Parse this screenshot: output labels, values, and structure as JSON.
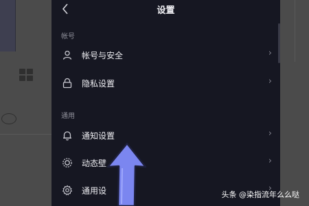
{
  "header": {
    "back_icon": "chevron-left-icon",
    "title": "设置"
  },
  "sections": [
    {
      "heading": "帐号",
      "items": [
        {
          "label": "帐号与安全",
          "icon": "user-icon"
        },
        {
          "label": "隐私设置",
          "icon": "lock-icon"
        }
      ]
    },
    {
      "heading": "通用",
      "items": [
        {
          "label": "通知设置",
          "icon": "bell-icon"
        },
        {
          "label": "动态壁",
          "icon": "wallpaper-icon"
        },
        {
          "label": "通用设",
          "icon": "gear-icon"
        }
      ]
    }
  ],
  "chevron_glyph": "›",
  "annotation": {
    "color": "#7b86f0",
    "icon": "pointer-arrow-icon"
  },
  "watermark": "头条 @染指流年么么哒"
}
